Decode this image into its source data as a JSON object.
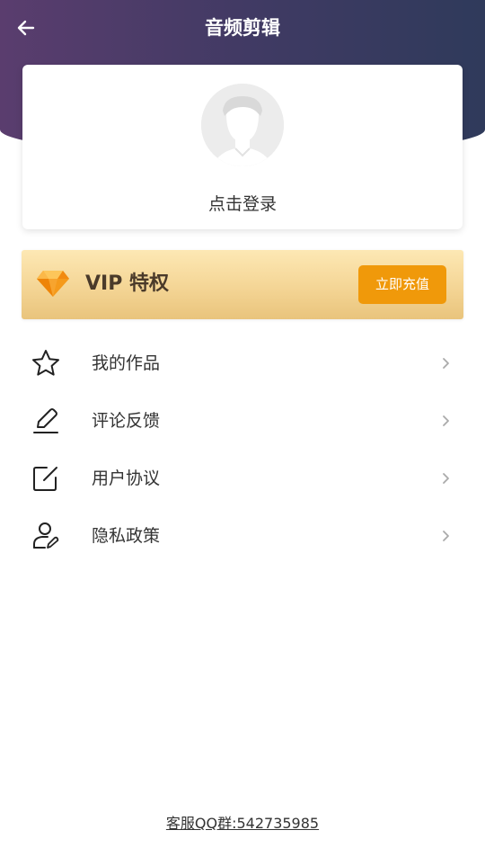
{
  "header": {
    "title": "音频剪辑",
    "back_icon": "arrow-left-icon"
  },
  "profile": {
    "avatar_icon": "default-avatar-icon",
    "login_label": "点击登录"
  },
  "vip": {
    "gem_icon": "diamond-icon",
    "title": "VIP 特权",
    "button_label": "立即充值",
    "button_color": "#f0990a"
  },
  "menu": {
    "items": [
      {
        "label": "我的作品",
        "icon": "star-icon"
      },
      {
        "label": "评论反馈",
        "icon": "pen-icon"
      },
      {
        "label": "用户协议",
        "icon": "edit-icon"
      },
      {
        "label": "隐私政策",
        "icon": "user-edit-icon"
      }
    ]
  },
  "footer": {
    "service_text": "客服QQ群:542735985"
  },
  "colors": {
    "header_start": "#5a3d6e",
    "header_end": "#2f3a5b",
    "accent": "#f0990a"
  }
}
